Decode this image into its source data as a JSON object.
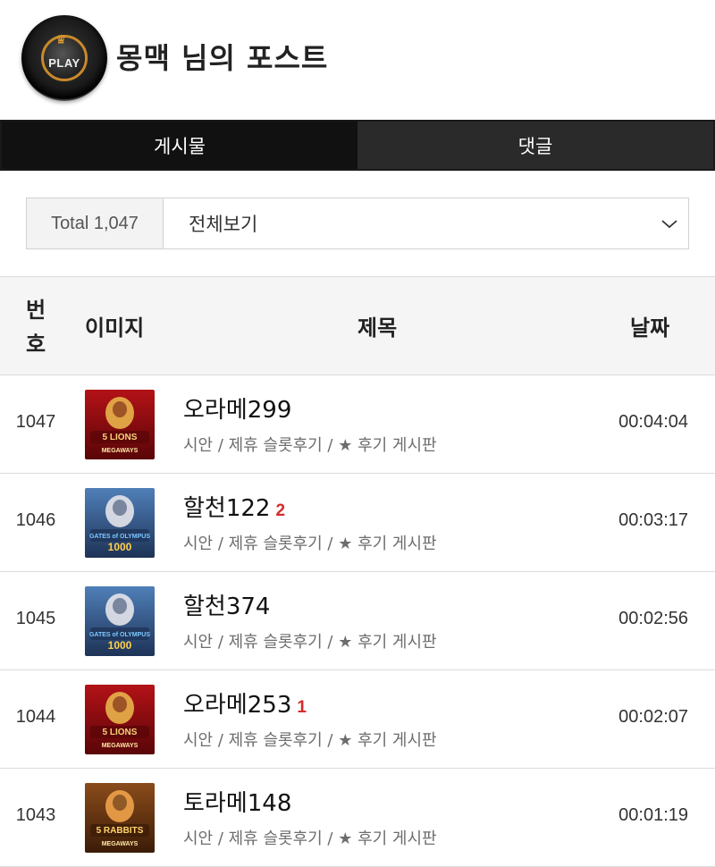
{
  "header": {
    "title": "몽맥 님의 포스트",
    "avatar_text": "PLAY"
  },
  "tabs": [
    {
      "label": "게시물",
      "active": true
    },
    {
      "label": "댓글",
      "active": false
    }
  ],
  "filter": {
    "total_label": "Total 1,047",
    "select_value": "전체보기"
  },
  "table": {
    "headers": {
      "number": "번호",
      "number_line1": "번",
      "number_line2": "호",
      "image": "이미지",
      "title": "제목",
      "date": "날짜"
    },
    "rows": [
      {
        "number": "1047",
        "title": "오라메299",
        "comment_count": "",
        "category": "시안 / 제휴 슬롯후기 / ★ 후기 게시판",
        "date": "00:04:04",
        "thumb": "lions"
      },
      {
        "number": "1046",
        "title": "할천122",
        "comment_count": "2",
        "category": "시안 / 제휴 슬롯후기 / ★ 후기 게시판",
        "date": "00:03:17",
        "thumb": "olympus"
      },
      {
        "number": "1045",
        "title": "할천374",
        "comment_count": "",
        "category": "시안 / 제휴 슬롯후기 / ★ 후기 게시판",
        "date": "00:02:56",
        "thumb": "olympus"
      },
      {
        "number": "1044",
        "title": "오라메253",
        "comment_count": "1",
        "category": "시안 / 제휴 슬롯후기 / ★ 후기 게시판",
        "date": "00:02:07",
        "thumb": "lions"
      },
      {
        "number": "1043",
        "title": "토라메148",
        "comment_count": "",
        "category": "시안 / 제휴 슬롯후기 / ★ 후기 게시판",
        "date": "00:01:19",
        "thumb": "rabbits"
      }
    ]
  },
  "thumbs": {
    "lions": {
      "line1": "5 LIONS",
      "line2": "MEGAWAYS"
    },
    "olympus": {
      "line1": "GATES of OLYMPUS",
      "line2": "1000"
    },
    "rabbits": {
      "line1": "5 RABBITS",
      "line2": "MEGAWAYS"
    }
  },
  "colors": {
    "tab_active_bg": "#111111",
    "tab_inactive_bg": "#2a2a2a",
    "comment_count": "#d62a2a"
  }
}
